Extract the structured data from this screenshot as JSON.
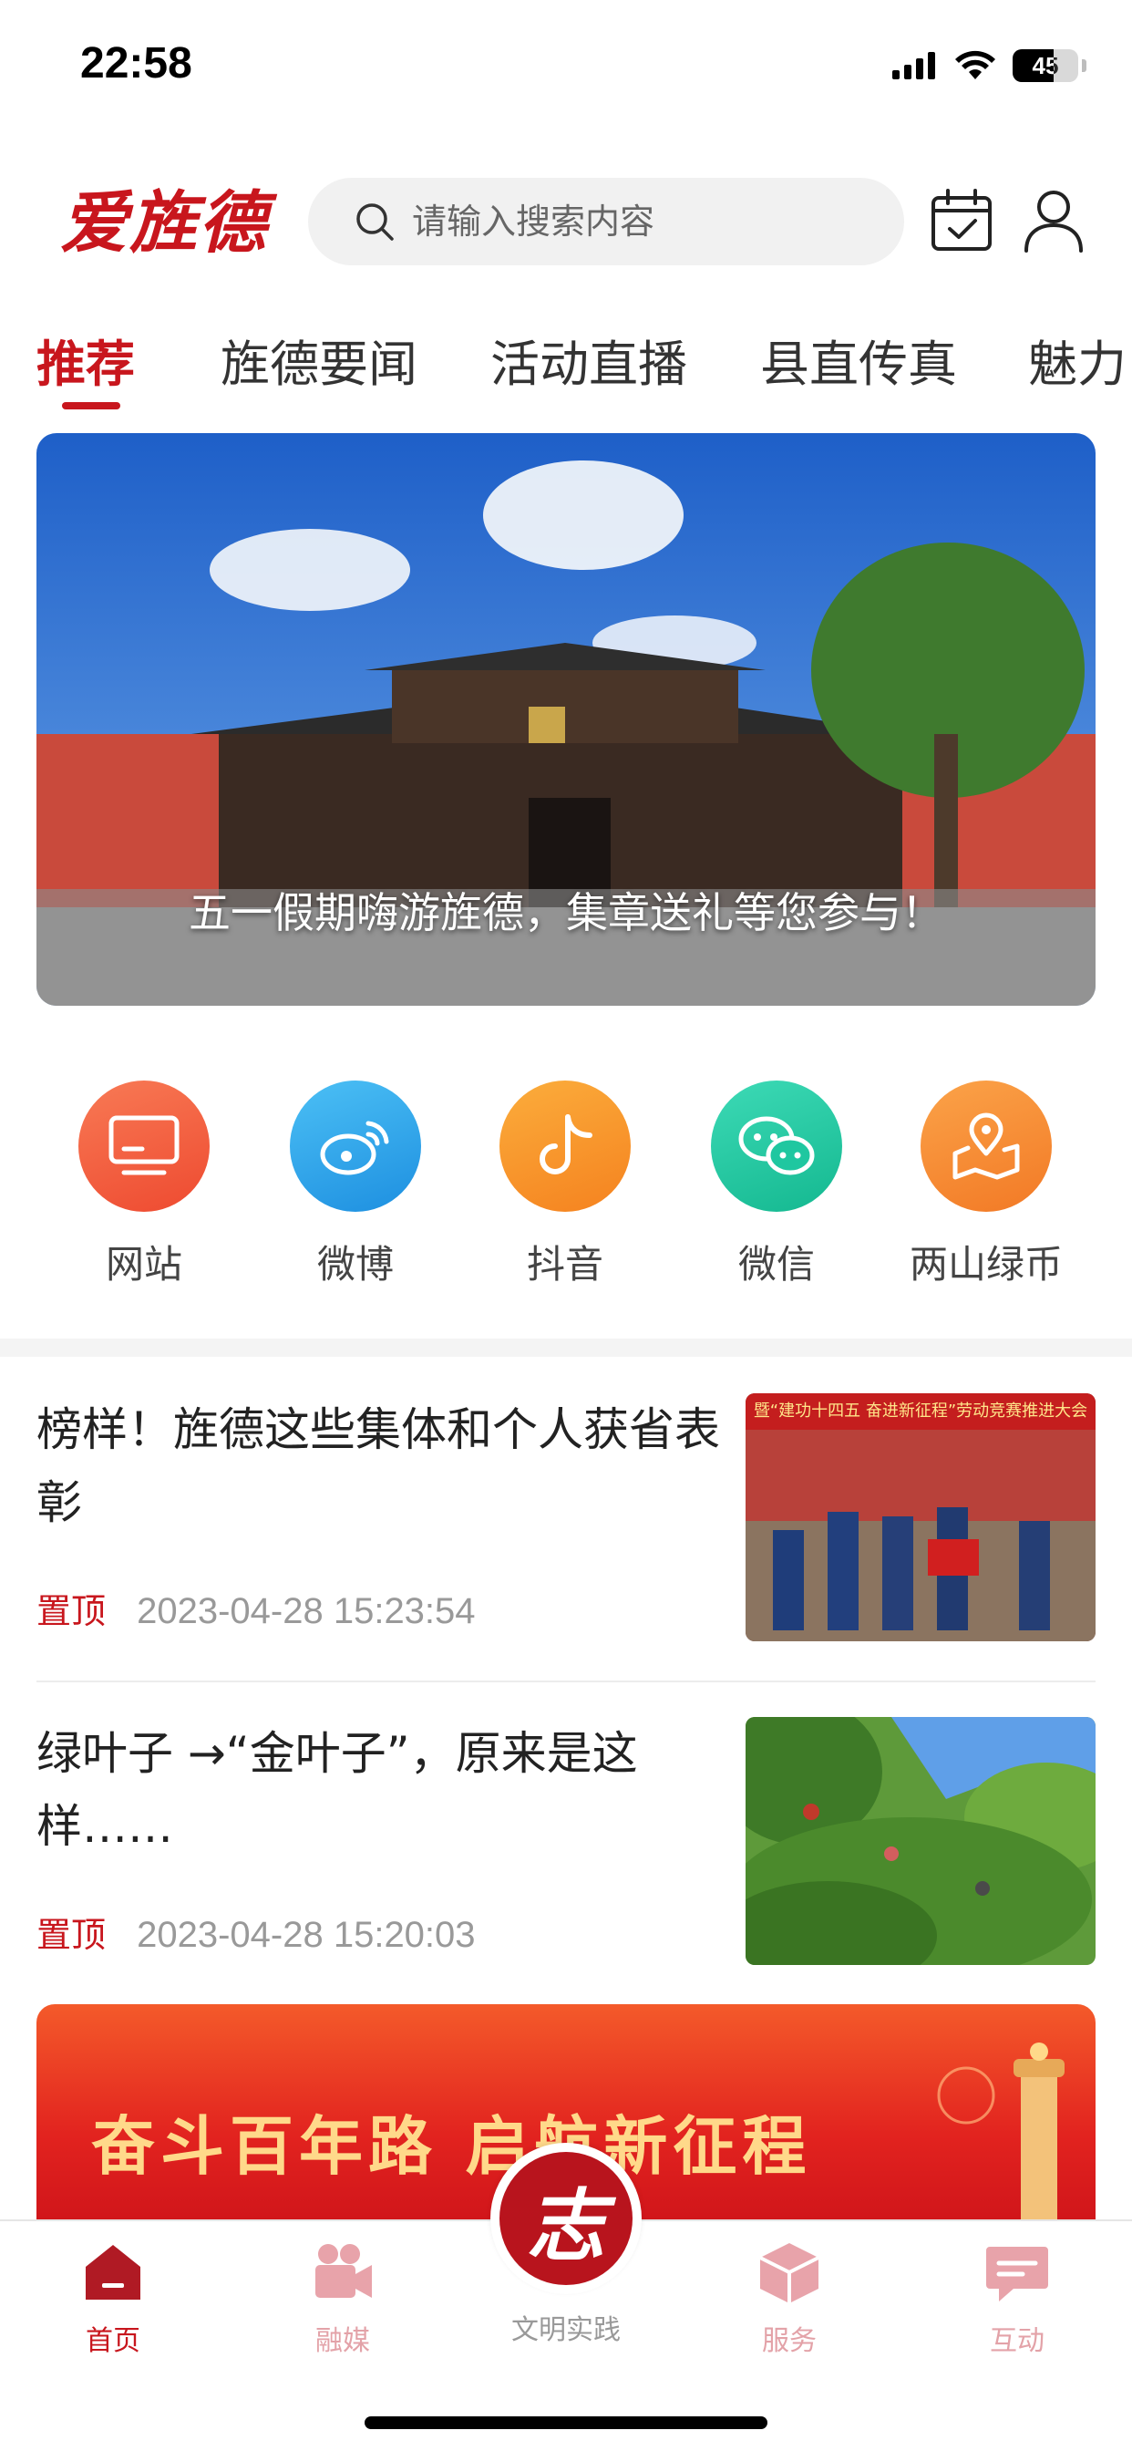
{
  "status_bar": {
    "time": "22:58",
    "battery": "45"
  },
  "header": {
    "logo": "爱旌德",
    "search_placeholder": "请输入搜索内容"
  },
  "tabs": [
    "推荐",
    "旌德要闻",
    "活动直播",
    "县直传真",
    "魅力"
  ],
  "banner": {
    "caption": "五一假期嗨游旌德，集章送礼等您参与！"
  },
  "quick_links": [
    {
      "label": "网站",
      "icon": "monitor-icon",
      "color": "#f2593a"
    },
    {
      "label": "微博",
      "icon": "weibo-icon",
      "color": "#2aa7ec"
    },
    {
      "label": "抖音",
      "icon": "douyin-icon",
      "color": "#f7931e"
    },
    {
      "label": "微信",
      "icon": "wechat-icon",
      "color": "#1fc7a0"
    },
    {
      "label": "两山绿币",
      "icon": "map-pin-icon",
      "color": "#f78b2c"
    }
  ],
  "news": [
    {
      "title": "榜样！旌德这些集体和个人获省表彰",
      "tag": "置顶",
      "time": "2023-04-28 15:23:54",
      "thumb_banner": "暨“建功十四五 奋进新征程”劳动竞赛推进大会"
    },
    {
      "title": "绿叶子 →“金叶子”，原来是这样……",
      "tag": "置顶",
      "time": "2023-04-28 15:20:03"
    }
  ],
  "promo": {
    "text": "奋斗百年路 启航新征程"
  },
  "bottom_nav": {
    "items": [
      {
        "label": "首页",
        "icon": "home-icon",
        "active": true
      },
      {
        "label": "融媒",
        "icon": "video-camera-icon"
      },
      {
        "label": "文明实践",
        "icon": "volunteer-icon"
      },
      {
        "label": "服务",
        "icon": "box-icon"
      },
      {
        "label": "互动",
        "icon": "chat-icon"
      }
    ],
    "center_glyph": "志"
  },
  "colors": {
    "brand": "#c8161d",
    "nav_inactive": "#e3a2a8"
  }
}
